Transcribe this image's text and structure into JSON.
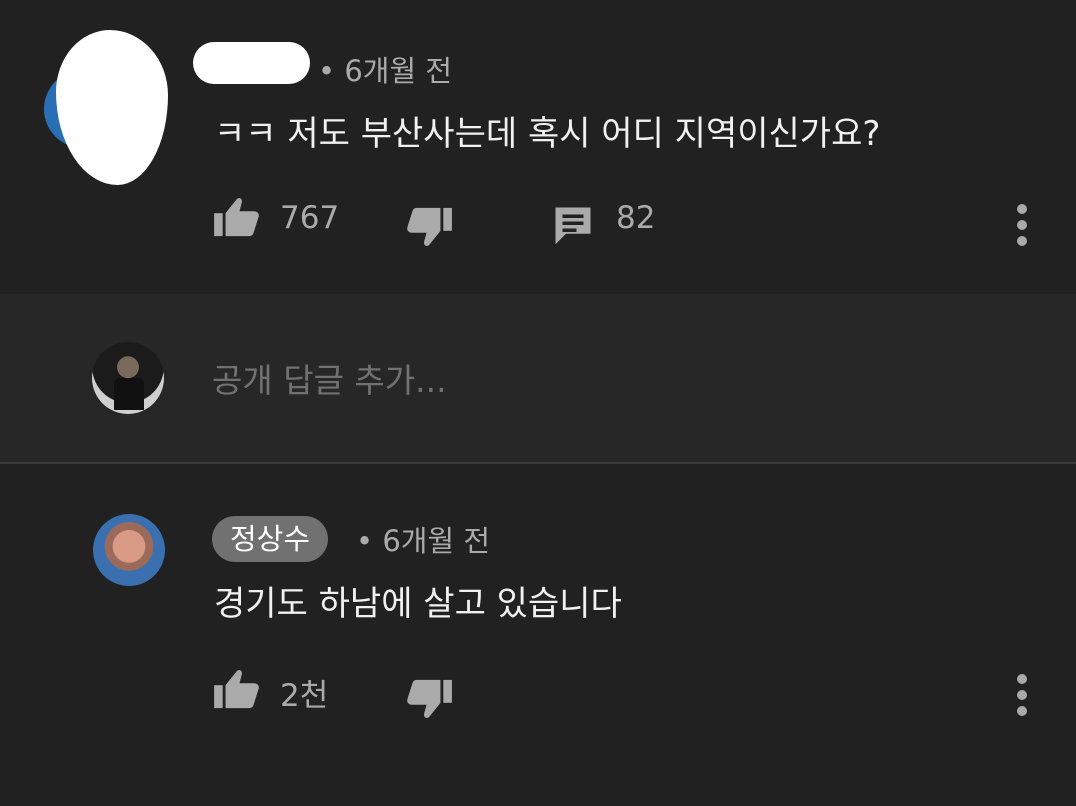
{
  "top_comment": {
    "meta": "• 6개월 전",
    "text": "ㅋㅋ 저도 부산사는데 혹시 어디 지역이신가요?",
    "like_count": "767",
    "reply_count": "82"
  },
  "reply_box": {
    "placeholder": "공개 답글 추가..."
  },
  "reply_comment": {
    "author": "정상수",
    "meta": "• 6개월 전",
    "text": "경기도 하남에 살고 있습니다",
    "like_count": "2천"
  },
  "icons": {
    "like": "thumbs-up-icon",
    "dislike": "thumbs-down-icon",
    "reply": "comment-icon",
    "more": "more-vert-icon"
  }
}
